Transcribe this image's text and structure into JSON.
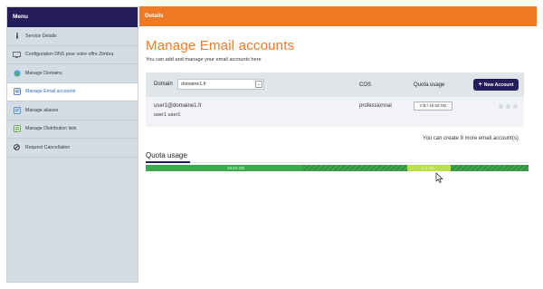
{
  "sidebar": {
    "header": "Menu",
    "items": [
      {
        "label": "Service Details",
        "icon": "info-icon",
        "active": false
      },
      {
        "label": "Configuration DNS pour votre offre Zimbra",
        "icon": "monitor-icon",
        "active": false
      },
      {
        "label": "Manage Domains",
        "icon": "globe-icon",
        "active": false
      },
      {
        "label": "Manage Email accounts",
        "icon": "mail-icon",
        "active": true
      },
      {
        "label": "Manage aliases",
        "icon": "alias-icon",
        "active": false
      },
      {
        "label": "Manage Distribution lists",
        "icon": "list-icon",
        "active": false
      },
      {
        "label": "Request Cancellation",
        "icon": "ban-icon",
        "active": false
      }
    ]
  },
  "main": {
    "header": "Details",
    "title": "Manage Email accounts",
    "subtitle": "You can add and manage your email accounts here",
    "table": {
      "domain_label": "Domain",
      "domain_value": "domaine1.fr",
      "col_cos": "COS",
      "col_quota": "Quota usage",
      "new_button": "New Account",
      "rows": [
        {
          "email": "user1@domaine1.fr",
          "name": "user1 user1",
          "cos": "professionnal",
          "quota": "0 B / 19.53 GB"
        }
      ]
    },
    "create_note": "You can create 9 more email account(s)",
    "quota": {
      "title": "Quota usage",
      "label_used": "19.53 GB",
      "label_free": "0.1 GB"
    }
  },
  "colors": {
    "menu_header": "#251d5a",
    "details_header": "#f07a24",
    "title": "#f07a24",
    "bar_green": "#3aaa4a",
    "bar_light": "#b9e04a",
    "active_item": "#2e6cc4"
  }
}
